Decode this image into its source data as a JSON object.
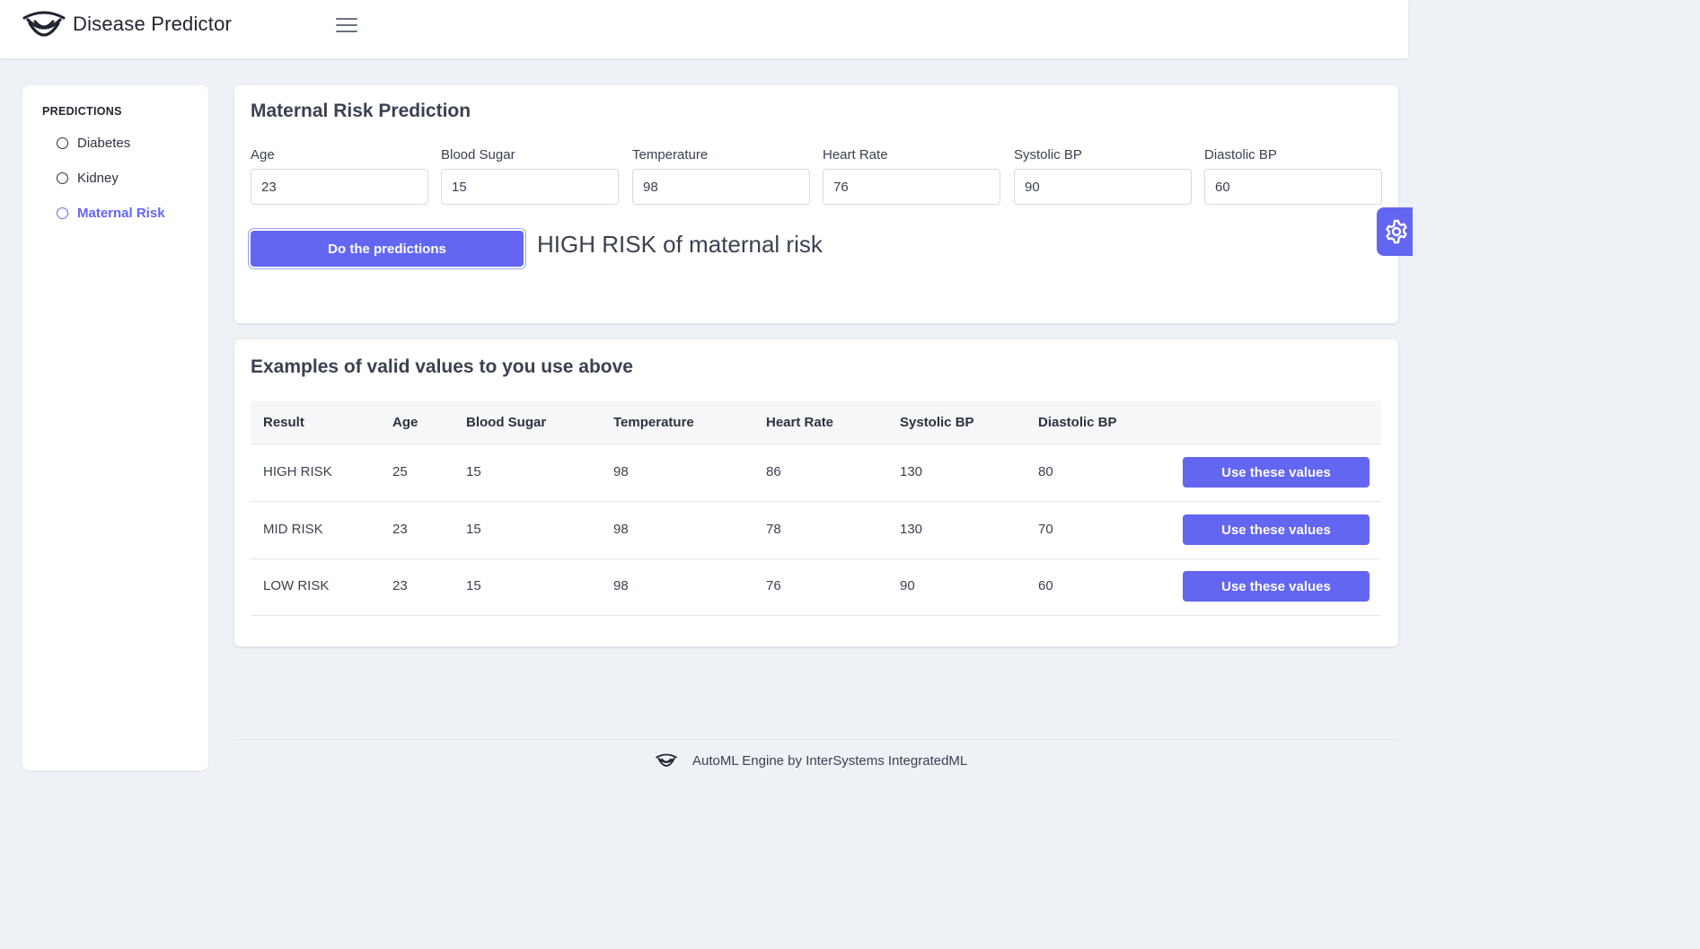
{
  "header": {
    "app_title": "Disease Predictor",
    "logo_icon": "eye-smile-logo",
    "menu_icon": "hamburger-icon"
  },
  "sidebar": {
    "heading": "PREDICTIONS",
    "items": [
      {
        "label": "Diabetes",
        "active": false
      },
      {
        "label": "Kidney",
        "active": false
      },
      {
        "label": "Maternal Risk",
        "active": true
      }
    ]
  },
  "prediction_form": {
    "title": "Maternal Risk Prediction",
    "fields": [
      {
        "label": "Age",
        "value": "23"
      },
      {
        "label": "Blood Sugar",
        "value": "15"
      },
      {
        "label": "Temperature",
        "value": "98"
      },
      {
        "label": "Heart Rate",
        "value": "76"
      },
      {
        "label": "Systolic BP",
        "value": "90"
      },
      {
        "label": "Diastolic BP",
        "value": "60"
      }
    ],
    "submit_label": "Do the predictions",
    "result": "HIGH RISK of maternal risk"
  },
  "examples": {
    "title": "Examples of valid values to you use above",
    "columns": [
      "Result",
      "Age",
      "Blood Sugar",
      "Temperature",
      "Heart Rate",
      "Systolic BP",
      "Diastolic BP"
    ],
    "rows": [
      {
        "cells": [
          "HIGH RISK",
          "25",
          "15",
          "98",
          "86",
          "130",
          "80"
        ],
        "action": "Use these values"
      },
      {
        "cells": [
          "MID RISK",
          "23",
          "15",
          "98",
          "78",
          "130",
          "70"
        ],
        "action": "Use these values"
      },
      {
        "cells": [
          "LOW RISK",
          "23",
          "15",
          "98",
          "76",
          "90",
          "60"
        ],
        "action": "Use these values"
      }
    ]
  },
  "settings": {
    "icon": "gear-icon"
  },
  "footer": {
    "text": "AutoML Engine by InterSystems IntegratedML"
  },
  "colors": {
    "accent": "#6366f1",
    "background": "#eef1f5"
  }
}
